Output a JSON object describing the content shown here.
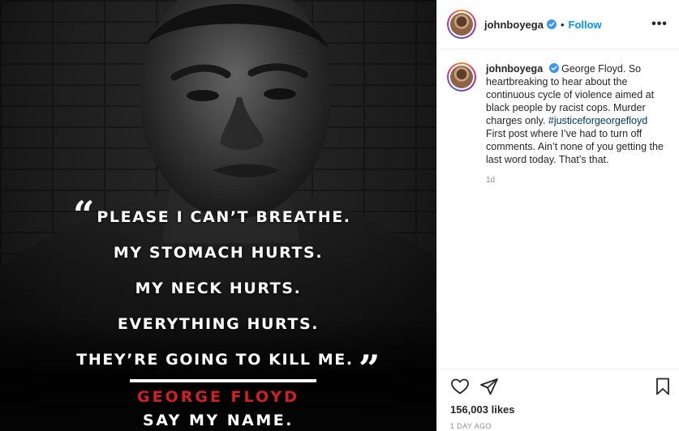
{
  "media": {
    "quote_lines": [
      "PLEASE I CAN’T BREATHE.",
      "MY STOMACH HURTS.",
      "MY NECK HURTS.",
      "EVERYTHING HURTS.",
      "THEY’RE GOING TO KILL ME."
    ],
    "open_quote": "“",
    "close_quote": "”",
    "name": "GEORGE FLOYD",
    "tagline": "SAY MY NAME.",
    "name_color": "#d11f25"
  },
  "header": {
    "username": "johnboyega",
    "separator": "•",
    "follow_label": "Follow",
    "more_label": "•••"
  },
  "caption": {
    "username": "johnboyega",
    "text_before_hashtag": "George Floyd. So heartbreaking to hear about the continuous cycle of violence aimed at black people by racist cops. Murder charges only.",
    "hashtag": "#justiceforgeorgefloyd",
    "text_after_hashtag": "First post where I’ve had to turn off comments. Ain’t none of you getting the last word today. That’s that.",
    "time_ago": "1d"
  },
  "footer": {
    "likes": "156,003 likes",
    "date": "1 DAY AGO",
    "icons": [
      "heart-icon",
      "share-icon",
      "bookmark-icon"
    ]
  },
  "colors": {
    "link_blue": "#0095f6",
    "verified_blue": "#3897f0",
    "hashtag": "#00376b",
    "muted": "#8e8e8e"
  }
}
